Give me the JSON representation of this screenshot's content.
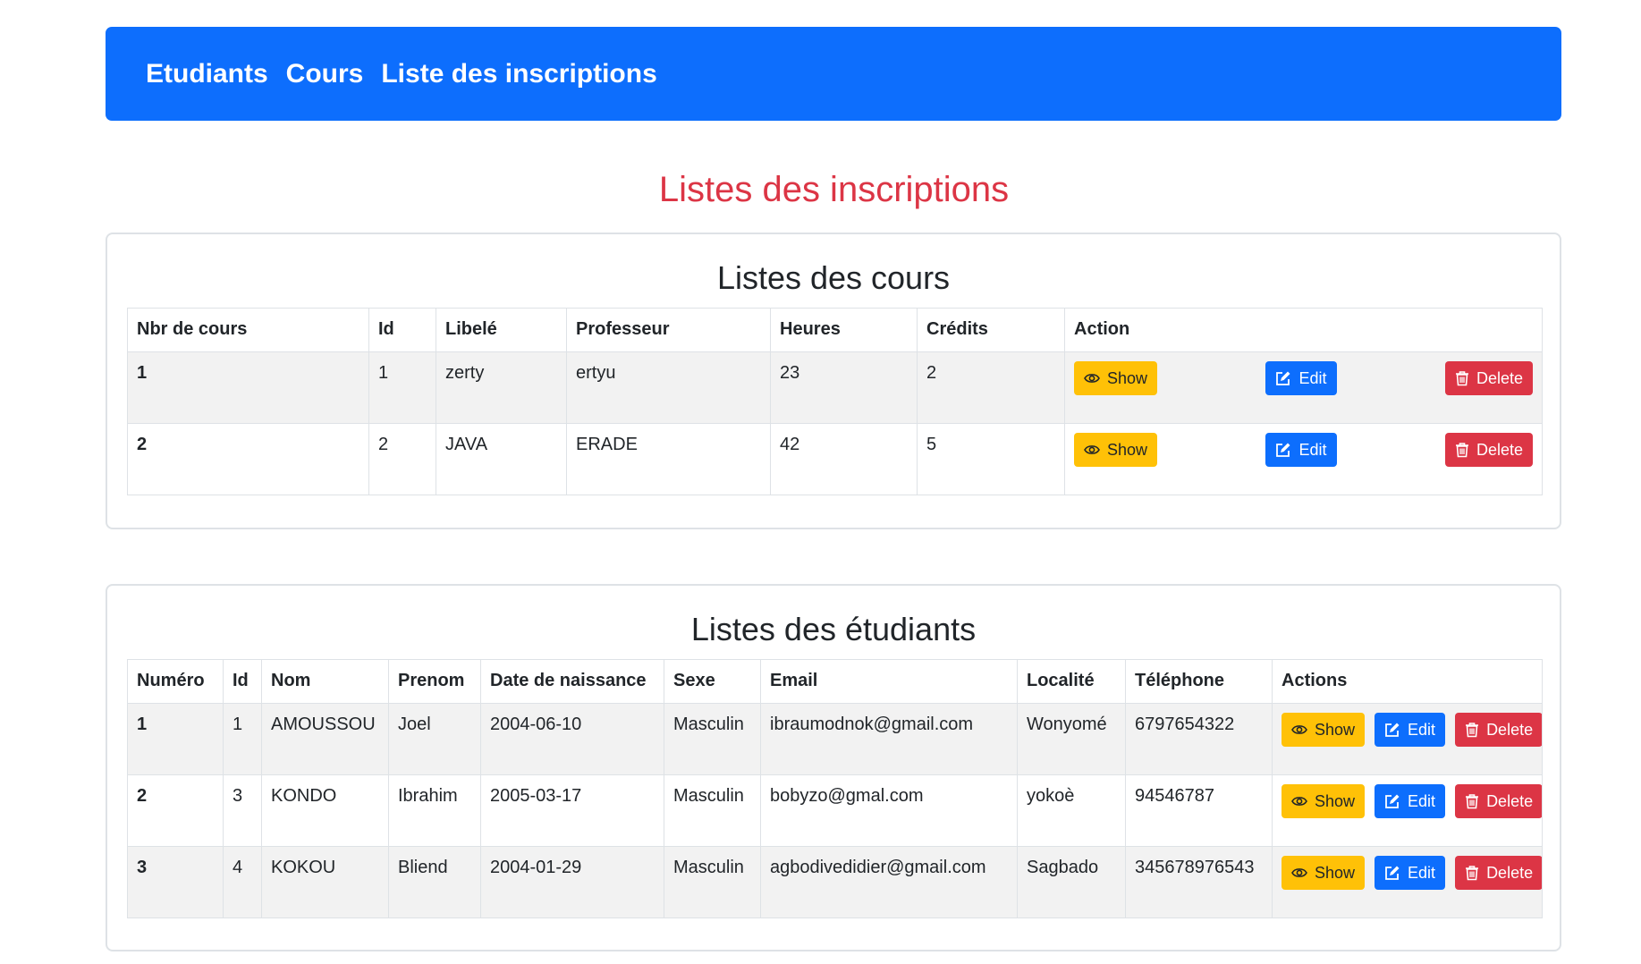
{
  "navbar": {
    "links": [
      "Etudiants",
      "Cours",
      "Liste des inscriptions"
    ]
  },
  "page_title": "Listes des inscriptions",
  "colors": {
    "primary": "#0d6efd",
    "danger": "#dc3545",
    "warning": "#ffc107"
  },
  "courses": {
    "title": "Listes des cours",
    "headers": [
      "Nbr de cours",
      "Id",
      "Libelé",
      "Professeur",
      "Heures",
      "Crédits",
      "Action"
    ],
    "rows": [
      [
        "1",
        "1",
        "zerty",
        "ertyu",
        "23",
        "2"
      ],
      [
        "2",
        "2",
        "JAVA",
        "ERADE",
        "42",
        "5"
      ]
    ]
  },
  "students": {
    "title": "Listes des étudiants",
    "headers": [
      "Numéro",
      "Id",
      "Nom",
      "Prenom",
      "Date de naissance",
      "Sexe",
      "Email",
      "Localité",
      "Téléphone",
      "Actions"
    ],
    "rows": [
      [
        "1",
        "1",
        "AMOUSSOU",
        "Joel",
        "2004-06-10",
        "Masculin",
        "ibraumodnok@gmail.com",
        "Wonyomé",
        "6797654322"
      ],
      [
        "2",
        "3",
        "KONDO",
        "Ibrahim",
        "2005-03-17",
        "Masculin",
        "bobyzo@gmal.com",
        "yokoè",
        "94546787"
      ],
      [
        "3",
        "4",
        "KOKOU",
        "Bliend",
        "2004-01-29",
        "Masculin",
        "agbodivedidier@gmail.com",
        "Sagbado",
        "345678976543"
      ]
    ]
  },
  "buttons": {
    "show": "Show",
    "edit": "Edit",
    "delete": "Delete",
    "icons": [
      "eye-icon",
      "edit-icon",
      "trash-icon"
    ]
  }
}
